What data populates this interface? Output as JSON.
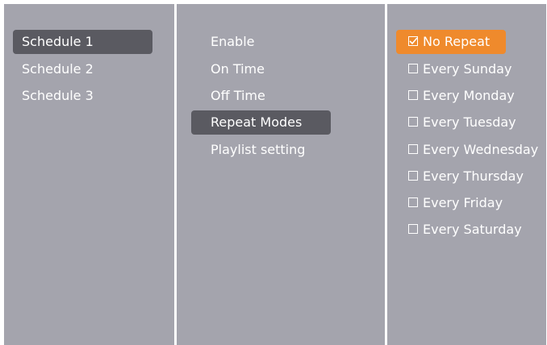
{
  "schedules": {
    "items": [
      {
        "label": "Schedule 1",
        "selected": true
      },
      {
        "label": "Schedule 2",
        "selected": false
      },
      {
        "label": "Schedule 3",
        "selected": false
      }
    ]
  },
  "settings": {
    "items": [
      {
        "label": "Enable",
        "selected": false
      },
      {
        "label": "On Time",
        "selected": false
      },
      {
        "label": "Off Time",
        "selected": false
      },
      {
        "label": "Repeat Modes",
        "selected": true
      },
      {
        "label": "Playlist setting",
        "selected": false
      }
    ]
  },
  "repeat_options": {
    "items": [
      {
        "label": "No Repeat",
        "checked": true,
        "highlighted": true
      },
      {
        "label": "Every Sunday",
        "checked": false,
        "highlighted": false
      },
      {
        "label": "Every Monday",
        "checked": false,
        "highlighted": false
      },
      {
        "label": "Every Tuesday",
        "checked": false,
        "highlighted": false
      },
      {
        "label": "Every Wednesday",
        "checked": false,
        "highlighted": false
      },
      {
        "label": "Every Thursday",
        "checked": false,
        "highlighted": false
      },
      {
        "label": "Every Friday",
        "checked": false,
        "highlighted": false
      },
      {
        "label": "Every Saturday",
        "checked": false,
        "highlighted": false
      }
    ]
  },
  "colors": {
    "panel_bg": "#a4a4ad",
    "selected_bg": "#5a5a61",
    "highlight_bg": "#ef8a2c",
    "text": "#ffffff",
    "divider": "#ffffff"
  },
  "icons": {
    "checked": "checkbox-checked-icon",
    "unchecked": "checkbox-empty-icon"
  }
}
